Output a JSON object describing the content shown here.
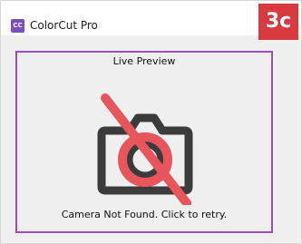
{
  "window": {
    "title": "ColorCut Pro",
    "icon_text": "CC",
    "icon": "app-logo-icon"
  },
  "overlay": {
    "step_label": "3c"
  },
  "preview": {
    "label": "Live Preview",
    "status": "Camera Not Found. Click to retry.",
    "icon": "camera-off-icon"
  },
  "colors": {
    "accent_purple": "#9b4fb8",
    "app_icon": "#7a4fbf",
    "badge_red": "#d83a3e",
    "slash_red": "#e8555b",
    "camera_dark": "#3b3b3b"
  }
}
